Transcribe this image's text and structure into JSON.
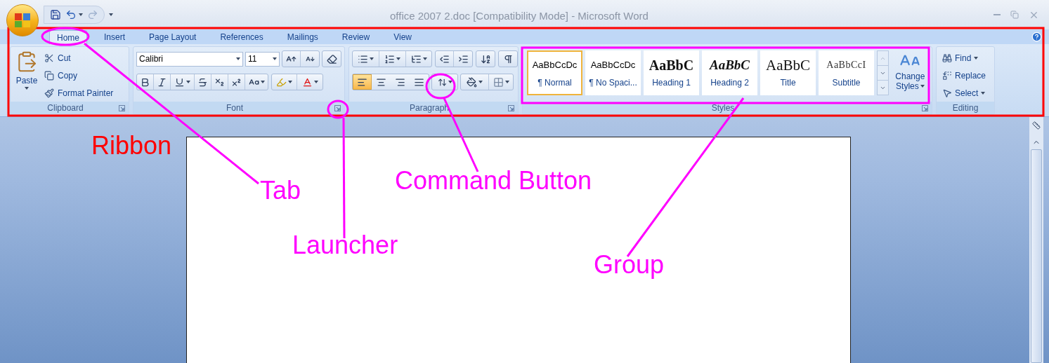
{
  "window": {
    "title": "office 2007 2.doc [Compatibility Mode] - Microsoft Word"
  },
  "tabs": [
    {
      "label": "Home",
      "selected": true
    },
    {
      "label": "Insert",
      "selected": false
    },
    {
      "label": "Page Layout",
      "selected": false
    },
    {
      "label": "References",
      "selected": false
    },
    {
      "label": "Mailings",
      "selected": false
    },
    {
      "label": "Review",
      "selected": false
    },
    {
      "label": "View",
      "selected": false
    }
  ],
  "clipboard": {
    "label": "Clipboard",
    "paste": "Paste",
    "commands": [
      "Cut",
      "Copy",
      "Format Painter"
    ]
  },
  "font": {
    "label": "Font",
    "font_name": "Calibri",
    "font_size": "11"
  },
  "paragraph": {
    "label": "Paragraph",
    "alignments": [
      {
        "selected": true
      },
      {
        "selected": false
      },
      {
        "selected": false
      },
      {
        "selected": false
      }
    ]
  },
  "styles": {
    "label": "Styles",
    "gallery": [
      {
        "kind": "normal",
        "preview": "AaBbCcDc",
        "name": "¶ Normal",
        "selected": true
      },
      {
        "kind": "normal",
        "preview": "AaBbCcDc",
        "name": "¶ No Spaci...",
        "selected": false
      },
      {
        "kind": "heading1",
        "preview": "AaBbC",
        "name": "Heading 1",
        "selected": false
      },
      {
        "kind": "heading2",
        "preview": "AaBbC",
        "name": "Heading 2",
        "selected": false
      },
      {
        "kind": "title",
        "preview": "AaBbC",
        "name": "Title",
        "selected": false
      },
      {
        "kind": "subtitle",
        "preview": "AaBbCcI",
        "name": "Subtitle",
        "selected": false
      }
    ],
    "change_styles": [
      "Change",
      "Styles"
    ]
  },
  "editing": {
    "label": "Editing",
    "commands": [
      "Find",
      "Replace",
      "Select"
    ]
  },
  "annotations": [
    {
      "text": "Ribbon",
      "color": "#ff0000"
    },
    {
      "text": "Tab",
      "color": "#ff00ff"
    },
    {
      "text": "Command Button",
      "color": "#ff00ff"
    },
    {
      "text": "Launcher",
      "color": "#ff00ff"
    },
    {
      "text": "Group",
      "color": "#ff00ff"
    }
  ]
}
